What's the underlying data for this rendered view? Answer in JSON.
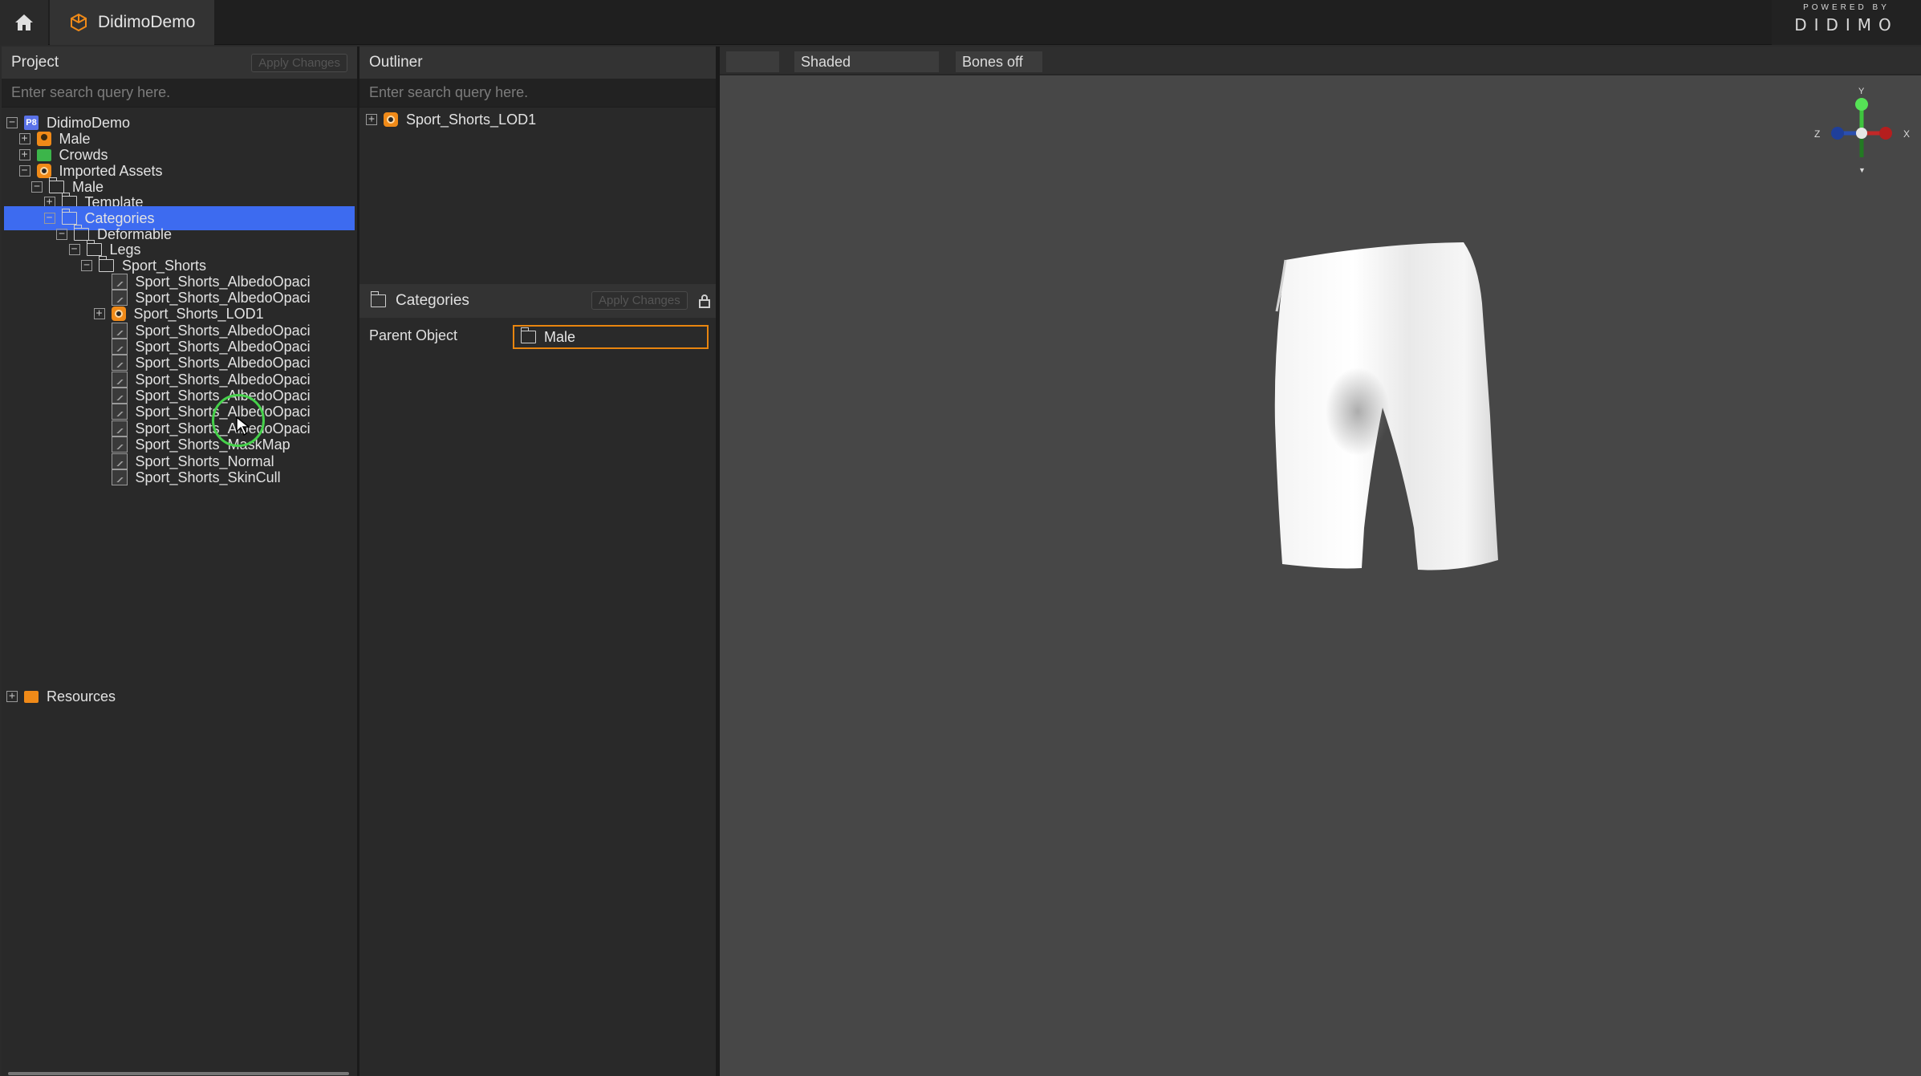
{
  "app": {
    "tab_title": "DidimoDemo",
    "powered_by": "POWERED BY",
    "brand": "DIDIMO"
  },
  "project_panel": {
    "title": "Project",
    "apply_label": "Apply Changes",
    "search_placeholder": "Enter search query here.",
    "tree": [
      {
        "label": "DidimoDemo",
        "toggle": "−",
        "icon": "project-icon",
        "level": 0
      },
      {
        "label": "Male",
        "toggle": "+",
        "icon": "character-icon",
        "level": 1
      },
      {
        "label": "Crowds",
        "toggle": "+",
        "icon": "crowd-icon",
        "level": 1
      },
      {
        "label": "Imported Assets",
        "toggle": "−",
        "icon": "asset-icon",
        "level": 1
      },
      {
        "label": "Male",
        "toggle": "−",
        "icon": "folder-icon",
        "level": 2
      },
      {
        "label": "Template",
        "toggle": "+",
        "icon": "folder-icon",
        "level": 3
      },
      {
        "label": "Categories",
        "toggle": "−",
        "icon": "folder-icon",
        "level": 3,
        "selected": true
      },
      {
        "label": "Deformable",
        "toggle": "−",
        "icon": "folder-icon",
        "level": 4
      },
      {
        "label": "Legs",
        "toggle": "−",
        "icon": "folder-icon",
        "level": 5
      },
      {
        "label": "Sport_Shorts",
        "toggle": "−",
        "icon": "folder-icon",
        "level": 6
      },
      {
        "label": "Sport_Shorts_AlbedoOpaci",
        "toggle": "",
        "icon": "texture-icon",
        "level": 7
      },
      {
        "label": "Sport_Shorts_AlbedoOpaci",
        "toggle": "",
        "icon": "texture-icon",
        "level": 7
      },
      {
        "label": "Sport_Shorts_LOD1",
        "toggle": "+",
        "icon": "mesh-icon",
        "level": 7
      },
      {
        "label": "Sport_Shorts_AlbedoOpaci",
        "toggle": "",
        "icon": "texture-icon",
        "level": 7
      },
      {
        "label": "Sport_Shorts_AlbedoOpaci",
        "toggle": "",
        "icon": "texture-icon",
        "level": 7
      },
      {
        "label": "Sport_Shorts_AlbedoOpaci",
        "toggle": "",
        "icon": "texture-icon",
        "level": 7
      },
      {
        "label": "Sport_Shorts_AlbedoOpaci",
        "toggle": "",
        "icon": "texture-icon",
        "level": 7
      },
      {
        "label": "Sport_Shorts_AlbedoOpaci",
        "toggle": "",
        "icon": "texture-icon",
        "level": 7
      },
      {
        "label": "Sport_Shorts_AlbedoOpaci",
        "toggle": "",
        "icon": "texture-icon",
        "level": 7
      },
      {
        "label": "Sport_Shorts_AlbedoOpaci",
        "toggle": "",
        "icon": "texture-icon",
        "level": 7
      },
      {
        "label": "Sport_Shorts_MaskMap",
        "toggle": "",
        "icon": "texture-icon",
        "level": 7
      },
      {
        "label": "Sport_Shorts_Normal",
        "toggle": "",
        "icon": "texture-icon",
        "level": 7
      },
      {
        "label": "Sport_Shorts_SkinCull",
        "toggle": "",
        "icon": "texture-icon",
        "level": 7
      }
    ],
    "resources": {
      "label": "Resources",
      "toggle": "+"
    }
  },
  "outliner": {
    "title": "Outliner",
    "search_placeholder": "Enter search query here.",
    "item": {
      "label": "Sport_Shorts_LOD1",
      "toggle": "+"
    }
  },
  "properties": {
    "title": "Categories",
    "apply_label": "Apply Changes",
    "parent_label": "Parent Object",
    "parent_value": "Male"
  },
  "viewport": {
    "shading": "Shaded",
    "bones": "Bones off",
    "gizmo": {
      "y": "Y",
      "x": "X",
      "z": "Z"
    }
  },
  "colors": {
    "selection": "#3d6bf0",
    "accent_orange": "#f08a18",
    "focus_ring": "#46d14b"
  }
}
